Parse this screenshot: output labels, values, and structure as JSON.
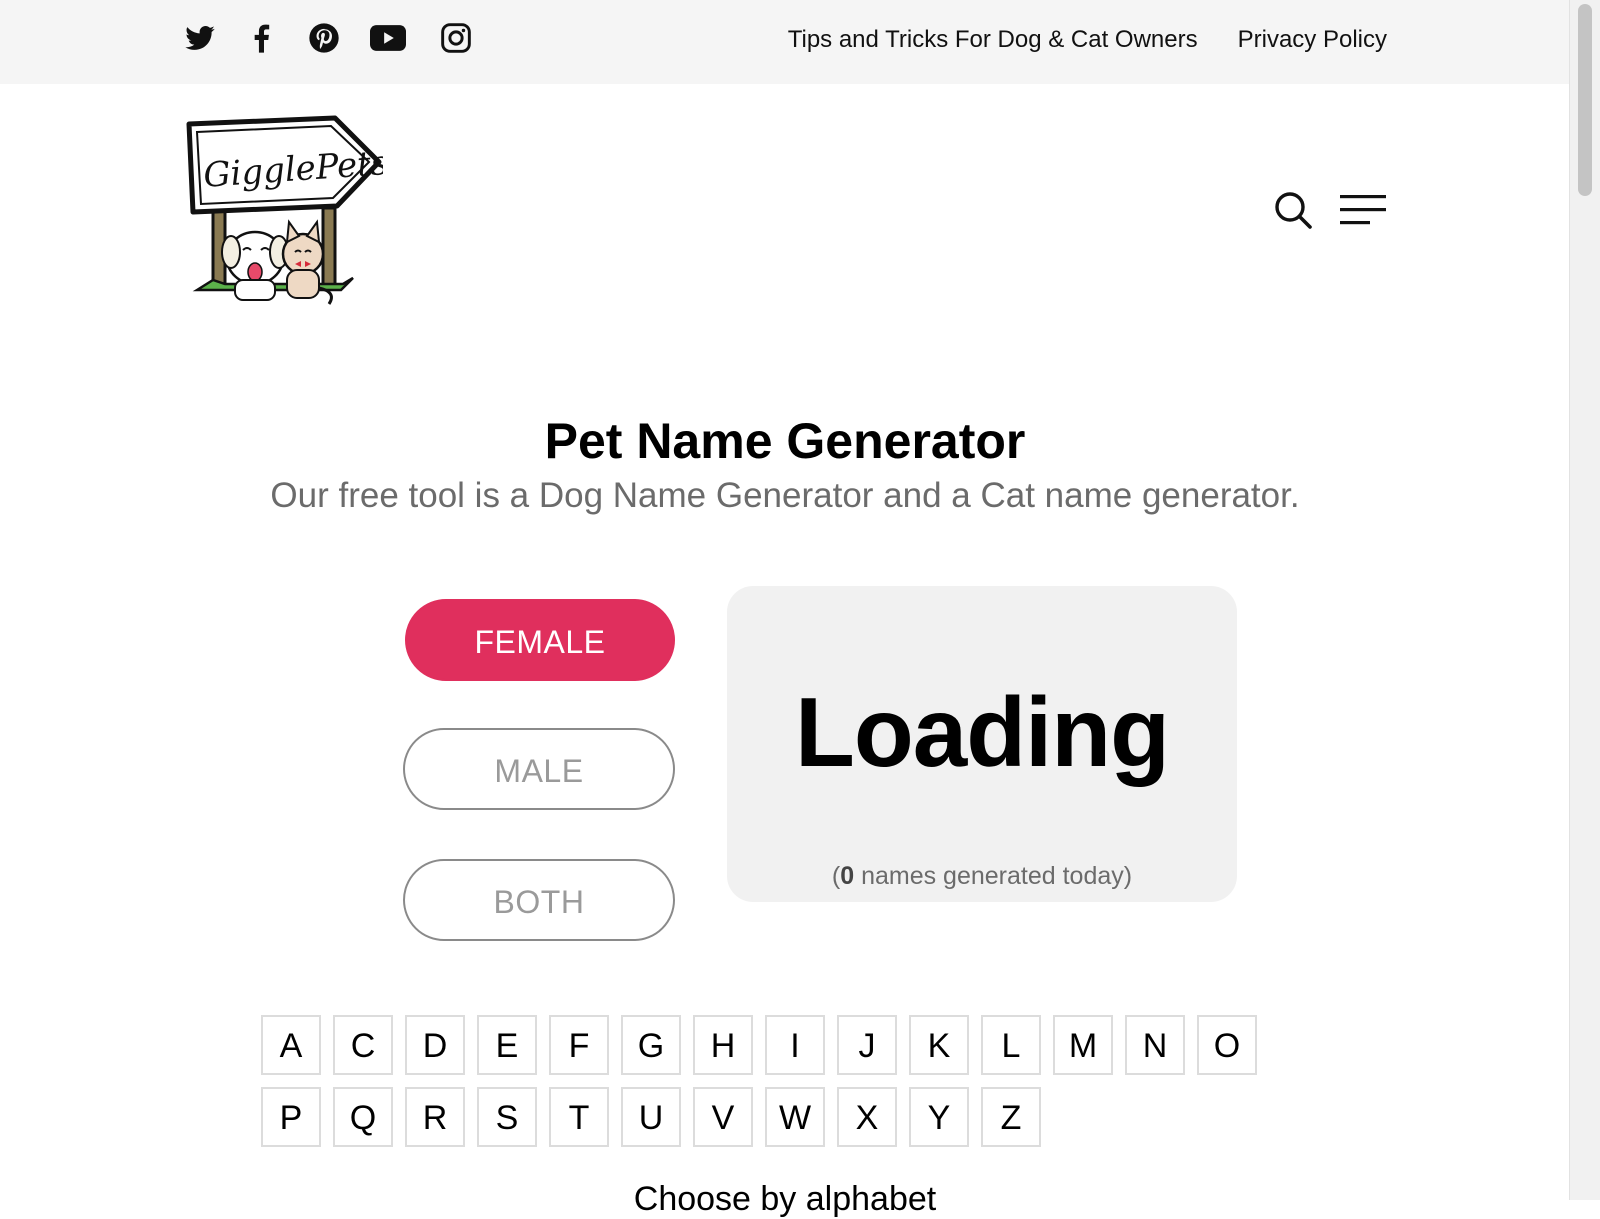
{
  "topbar": {
    "social": [
      {
        "name": "twitter-icon"
      },
      {
        "name": "facebook-icon"
      },
      {
        "name": "pinterest-icon"
      },
      {
        "name": "youtube-icon"
      },
      {
        "name": "instagram-icon"
      }
    ],
    "links": [
      "Tips and Tricks For Dog & Cat Owners",
      "Privacy Policy"
    ]
  },
  "header": {
    "logo_text": "GigglePets",
    "icons": [
      "search-icon",
      "menu-icon"
    ]
  },
  "main": {
    "title": "Pet Name Generator",
    "subtitle": "Our free tool is a Dog Name Generator and a Cat name generator.",
    "gender_buttons": [
      {
        "label": "FEMALE",
        "active": true
      },
      {
        "label": "MALE",
        "active": false
      },
      {
        "label": "BOTH",
        "active": false
      }
    ],
    "result": {
      "name": "Loading",
      "count_prefix": "(",
      "count": "0",
      "count_suffix": " names generated today)"
    },
    "alphabet_row1": [
      "A",
      "C",
      "D",
      "E",
      "F",
      "G",
      "H",
      "I",
      "J",
      "K",
      "L",
      "M",
      "N",
      "O"
    ],
    "alphabet_row2": [
      "P",
      "Q",
      "R",
      "S",
      "T",
      "U",
      "V",
      "W",
      "X",
      "Y",
      "Z"
    ],
    "alphabet_caption": "Choose by alphabet"
  },
  "colors": {
    "accent": "#e02f5d",
    "topbar_bg": "#f5f5f5",
    "card_bg": "#f1f1f1",
    "muted_text": "#6b6b6b"
  }
}
